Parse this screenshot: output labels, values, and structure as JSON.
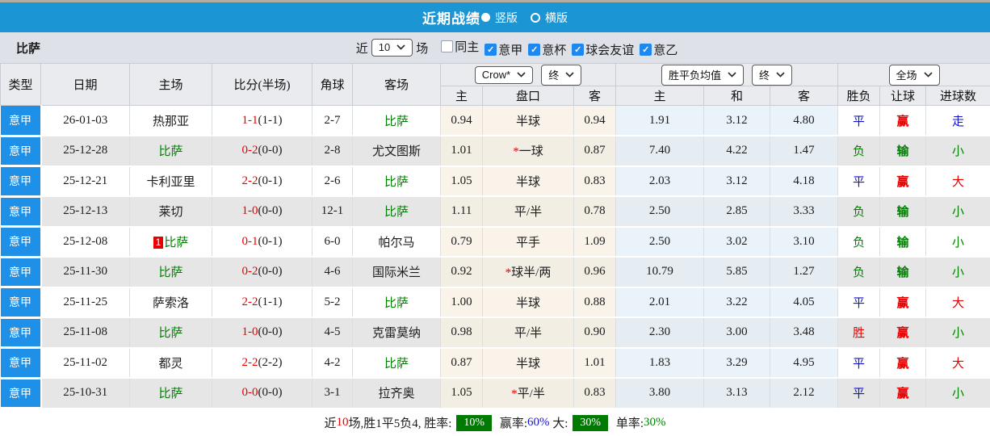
{
  "colors": {
    "title_bar_blue": "#1b95d3",
    "league_cell_blue": "#1f90e8",
    "checkbox_blue": "#1e88ee",
    "self_team_green": "#008000",
    "score_red": "#e60000",
    "draw_blue": "#1414cc",
    "odds_cream_bg": "#f9f3ea",
    "avg_blue_bg": "#eaf3fa",
    "badge_green_bg": "#007a00"
  },
  "icons": {
    "radio_selected": "●",
    "radio_unselected": "○",
    "checkbox_check": "✓",
    "chevron_down": "∨"
  },
  "title_bar": {
    "title": "近期战绩",
    "radio_vertical": "竖版",
    "radio_horizontal": "横版"
  },
  "filter_bar": {
    "team": "比萨",
    "near_label": "近",
    "matches_value": "10",
    "matches_label": "场",
    "checkboxes": [
      {
        "label": "同主",
        "checked": false
      },
      {
        "label": "意甲",
        "checked": true
      },
      {
        "label": "意杯",
        "checked": true
      },
      {
        "label": "球会友谊",
        "checked": true
      },
      {
        "label": "意乙",
        "checked": true
      }
    ]
  },
  "table": {
    "headers": {
      "type": "类型",
      "date": "日期",
      "home": "主场",
      "score": "比分(半场)",
      "corner": "角球",
      "away": "客场",
      "odds_select": "Crow*",
      "odds_final": "终",
      "avg_select": "胜平负均值",
      "avg_final": "终",
      "full_select": "全场",
      "sub": [
        "主",
        "盘口",
        "客",
        "主",
        "和",
        "客",
        "胜负",
        "让球",
        "进球数"
      ]
    },
    "rows": [
      {
        "type": "意甲",
        "date": "26-01-03",
        "home": {
          "text": "热那亚",
          "color": "black"
        },
        "score": {
          "ft": "1-1",
          "ht": "(1-1)"
        },
        "corner": "2-7",
        "away": {
          "text": "比萨",
          "color": "green"
        },
        "odds_home": "0.94",
        "handicap": {
          "star": false,
          "text": "半球"
        },
        "odds_away": "0.94",
        "avg_home": "1.91",
        "avg_draw": "3.12",
        "avg_away": "4.80",
        "result": {
          "text": "平",
          "color": "blue"
        },
        "let_ball": {
          "text": "赢",
          "color": "red"
        },
        "goals": {
          "text": "走",
          "color": "blue"
        }
      },
      {
        "type": "意甲",
        "date": "25-12-28",
        "home": {
          "text": "比萨",
          "color": "green"
        },
        "score": {
          "ft": "0-2",
          "ht": "(0-0)"
        },
        "corner": "2-8",
        "away": {
          "text": "尤文图斯",
          "color": "black"
        },
        "odds_home": "1.01",
        "handicap": {
          "star": true,
          "text": "一球"
        },
        "odds_away": "0.87",
        "avg_home": "7.40",
        "avg_draw": "4.22",
        "avg_away": "1.47",
        "result": {
          "text": "负",
          "color": "green"
        },
        "let_ball": {
          "text": "输",
          "color": "green"
        },
        "goals": {
          "text": "小",
          "color": "green"
        }
      },
      {
        "type": "意甲",
        "date": "25-12-21",
        "home": {
          "text": "卡利亚里",
          "color": "black"
        },
        "score": {
          "ft": "2-2",
          "ht": "(0-1)"
        },
        "corner": "2-6",
        "away": {
          "text": "比萨",
          "color": "green"
        },
        "odds_home": "1.05",
        "handicap": {
          "star": false,
          "text": "半球"
        },
        "odds_away": "0.83",
        "avg_home": "2.03",
        "avg_draw": "3.12",
        "avg_away": "4.18",
        "result": {
          "text": "平",
          "color": "blue"
        },
        "let_ball": {
          "text": "赢",
          "color": "red"
        },
        "goals": {
          "text": "大",
          "color": "red"
        }
      },
      {
        "type": "意甲",
        "date": "25-12-13",
        "home": {
          "text": "莱切",
          "color": "black"
        },
        "score": {
          "ft": "1-0",
          "ht": "(0-0)"
        },
        "corner": "12-1",
        "away": {
          "text": "比萨",
          "color": "green"
        },
        "odds_home": "1.11",
        "handicap": {
          "star": false,
          "text": "平/半"
        },
        "odds_away": "0.78",
        "avg_home": "2.50",
        "avg_draw": "2.85",
        "avg_away": "3.33",
        "result": {
          "text": "负",
          "color": "green"
        },
        "let_ball": {
          "text": "输",
          "color": "green"
        },
        "goals": {
          "text": "小",
          "color": "green"
        }
      },
      {
        "type": "意甲",
        "date": "25-12-08",
        "home": {
          "text": "比萨",
          "color": "green",
          "badge": "1"
        },
        "score": {
          "ft": "0-1",
          "ht": "(0-1)"
        },
        "corner": "6-0",
        "away": {
          "text": "帕尔马",
          "color": "black"
        },
        "odds_home": "0.79",
        "handicap": {
          "star": false,
          "text": "平手"
        },
        "odds_away": "1.09",
        "avg_home": "2.50",
        "avg_draw": "3.02",
        "avg_away": "3.10",
        "result": {
          "text": "负",
          "color": "green"
        },
        "let_ball": {
          "text": "输",
          "color": "green"
        },
        "goals": {
          "text": "小",
          "color": "green"
        }
      },
      {
        "type": "意甲",
        "date": "25-11-30",
        "home": {
          "text": "比萨",
          "color": "green"
        },
        "score": {
          "ft": "0-2",
          "ht": "(0-0)"
        },
        "corner": "4-6",
        "away": {
          "text": "国际米兰",
          "color": "black"
        },
        "odds_home": "0.92",
        "handicap": {
          "star": true,
          "text": "球半/两"
        },
        "odds_away": "0.96",
        "avg_home": "10.79",
        "avg_draw": "5.85",
        "avg_away": "1.27",
        "result": {
          "text": "负",
          "color": "green"
        },
        "let_ball": {
          "text": "输",
          "color": "green"
        },
        "goals": {
          "text": "小",
          "color": "green"
        }
      },
      {
        "type": "意甲",
        "date": "25-11-25",
        "home": {
          "text": "萨索洛",
          "color": "black"
        },
        "score": {
          "ft": "2-2",
          "ht": "(1-1)"
        },
        "corner": "5-2",
        "away": {
          "text": "比萨",
          "color": "green"
        },
        "odds_home": "1.00",
        "handicap": {
          "star": false,
          "text": "半球"
        },
        "odds_away": "0.88",
        "avg_home": "2.01",
        "avg_draw": "3.22",
        "avg_away": "4.05",
        "result": {
          "text": "平",
          "color": "blue"
        },
        "let_ball": {
          "text": "赢",
          "color": "red"
        },
        "goals": {
          "text": "大",
          "color": "red"
        }
      },
      {
        "type": "意甲",
        "date": "25-11-08",
        "home": {
          "text": "比萨",
          "color": "green"
        },
        "score": {
          "ft": "1-0",
          "ht": "(0-0)"
        },
        "corner": "4-5",
        "away": {
          "text": "克雷莫纳",
          "color": "black"
        },
        "odds_home": "0.98",
        "handicap": {
          "star": false,
          "text": "平/半"
        },
        "odds_away": "0.90",
        "avg_home": "2.30",
        "avg_draw": "3.00",
        "avg_away": "3.48",
        "result": {
          "text": "胜",
          "color": "red"
        },
        "let_ball": {
          "text": "赢",
          "color": "red"
        },
        "goals": {
          "text": "小",
          "color": "green"
        }
      },
      {
        "type": "意甲",
        "date": "25-11-02",
        "home": {
          "text": "都灵",
          "color": "black"
        },
        "score": {
          "ft": "2-2",
          "ht": "(2-2)"
        },
        "corner": "4-2",
        "away": {
          "text": "比萨",
          "color": "green"
        },
        "odds_home": "0.87",
        "handicap": {
          "star": false,
          "text": "半球"
        },
        "odds_away": "1.01",
        "avg_home": "1.83",
        "avg_draw": "3.29",
        "avg_away": "4.95",
        "result": {
          "text": "平",
          "color": "blue"
        },
        "let_ball": {
          "text": "赢",
          "color": "red"
        },
        "goals": {
          "text": "大",
          "color": "red"
        }
      },
      {
        "type": "意甲",
        "date": "25-10-31",
        "home": {
          "text": "比萨",
          "color": "green"
        },
        "score": {
          "ft": "0-0",
          "ht": "(0-0)"
        },
        "corner": "3-1",
        "away": {
          "text": "拉齐奥",
          "color": "black"
        },
        "odds_home": "1.05",
        "handicap": {
          "star": true,
          "text": "平/半"
        },
        "odds_away": "0.83",
        "avg_home": "3.80",
        "avg_draw": "3.13",
        "avg_away": "2.12",
        "result": {
          "text": "平",
          "color": "blue"
        },
        "let_ball": {
          "text": "赢",
          "color": "red"
        },
        "goals": {
          "text": "小",
          "color": "green"
        }
      }
    ]
  },
  "footer": {
    "prefix": "近",
    "count": "10",
    "mid": "场,胜1平5负4, 胜率:",
    "win_rate_badge": "10%",
    "label_win": " 赢率:",
    "win_pct": "60%",
    "label_big": " 大:",
    "big_badge": "30%",
    "label_single": " 单率:",
    "single_pct": "30%"
  }
}
